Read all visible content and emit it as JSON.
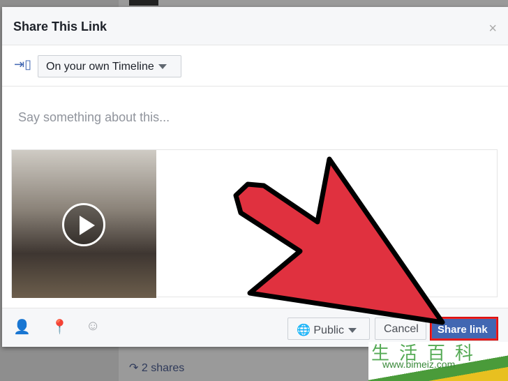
{
  "dialog": {
    "title": "Share This Link",
    "close": "×",
    "audience_select": "On your own Timeline",
    "composer_placeholder": "Say something about this...",
    "footer": {
      "privacy": "Public",
      "cancel": "Cancel",
      "share": "Share link"
    }
  },
  "page": {
    "shares": "2 shares"
  },
  "watermark": {
    "text": "www.bimeiz.com",
    "chars": "生活百科"
  },
  "colors": {
    "accent": "#4267b2",
    "arrow": "#e0313f"
  }
}
